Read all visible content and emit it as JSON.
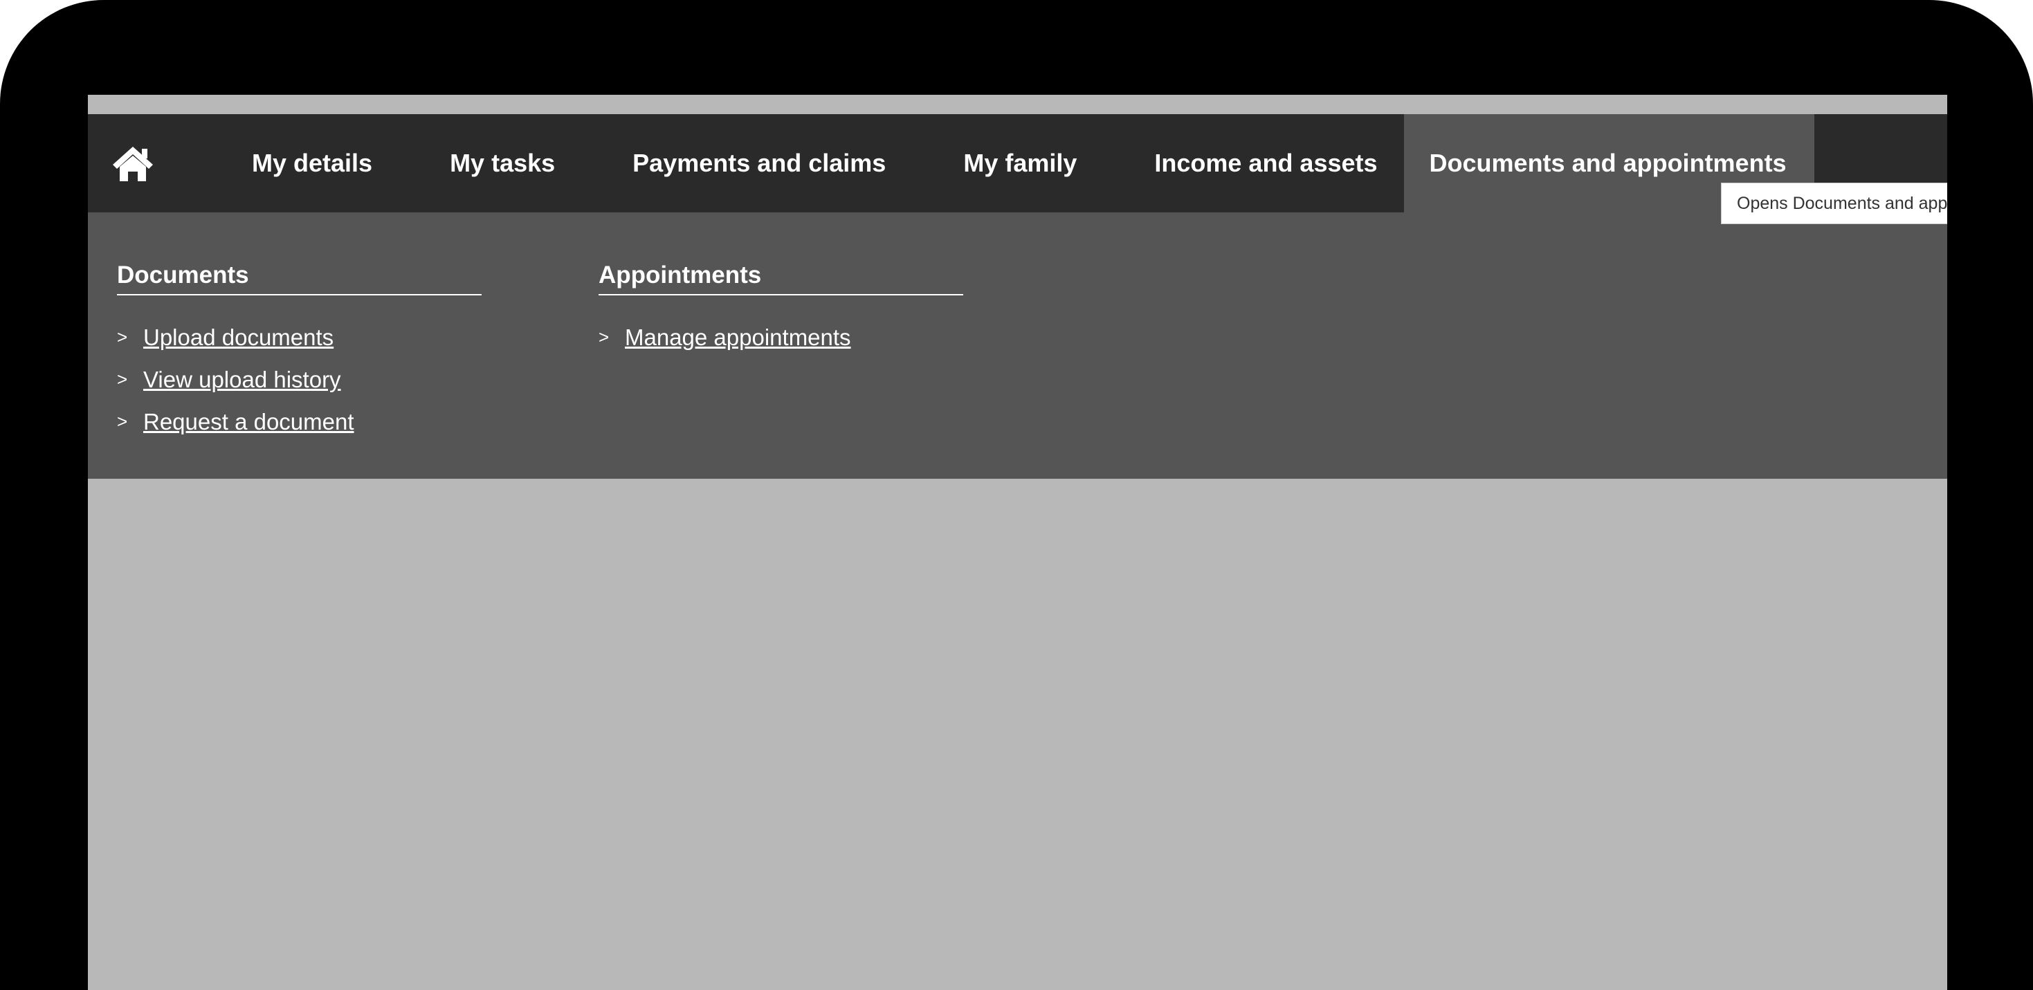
{
  "colors": {
    "frame": "#000000",
    "navbar": "#2a2a2a",
    "dropdown": "#555555",
    "content": "#b8b8b8",
    "text": "#ffffff"
  },
  "nav": {
    "home_icon": "home-icon",
    "items": [
      {
        "label": "My details"
      },
      {
        "label": "My tasks"
      },
      {
        "label": "Payments and claims"
      },
      {
        "label": "My family"
      },
      {
        "label": "Income and assets"
      },
      {
        "label": "Documents and appointments",
        "active": true
      }
    ]
  },
  "tooltip": {
    "text": "Opens Documents and appointments"
  },
  "dropdown": {
    "columns": [
      {
        "heading": "Documents",
        "links": [
          {
            "label": "Upload documents"
          },
          {
            "label": "View upload history"
          },
          {
            "label": "Request a document"
          }
        ]
      },
      {
        "heading": "Appointments",
        "links": [
          {
            "label": "Manage appointments"
          }
        ]
      }
    ],
    "chevron": ">"
  }
}
